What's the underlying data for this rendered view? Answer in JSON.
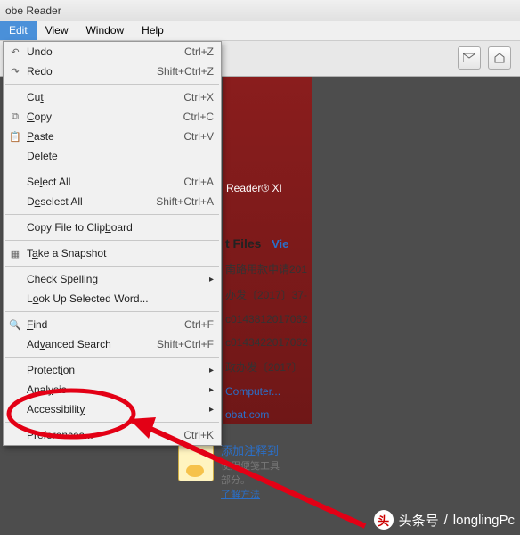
{
  "app": {
    "title": "obe Reader"
  },
  "menubar": {
    "edit": "Edit",
    "view": "View",
    "window": "Window",
    "help": "Help"
  },
  "menu": {
    "undo": "Undo",
    "undo_sc": "Ctrl+Z",
    "redo": "Redo",
    "redo_sc": "Shift+Ctrl+Z",
    "cut": "Cut",
    "cut_sc": "Ctrl+X",
    "copy": "Copy",
    "copy_sc": "Ctrl+C",
    "paste": "Paste",
    "paste_sc": "Ctrl+V",
    "delete": "Delete",
    "selectall": "Select All",
    "selectall_sc": "Ctrl+A",
    "deselectall": "Deselect All",
    "deselectall_sc": "Shift+Ctrl+A",
    "copyfile": "Copy File to Clipboard",
    "snapshot": "Take a Snapshot",
    "checkspell": "Check Spelling",
    "lookup": "Look Up Selected Word...",
    "find": "Find",
    "find_sc": "Ctrl+F",
    "advsearch": "Advanced Search",
    "advsearch_sc": "Shift+Ctrl+F",
    "protection": "Protection",
    "analysis": "Analysis",
    "accessibility": "Accessibility",
    "preferences": "Preferences...",
    "preferences_sc": "Ctrl+K"
  },
  "product": {
    "name": "Reader® XI"
  },
  "recent": {
    "title": "t Files",
    "viewall": "Vie",
    "items": [
      "南路用款申请201",
      "办发〔2017〕37-",
      "c0143812017062",
      "c0143422017062",
      "政办发〔2017〕",
      "Computer...",
      "obat.com"
    ]
  },
  "annotation": {
    "title": "添加注释到",
    "sub1": "使用便笺工具",
    "sub2": "部分。",
    "link": "了解方法"
  },
  "watermark": {
    "source": "头条号",
    "author": "longlingPc"
  }
}
